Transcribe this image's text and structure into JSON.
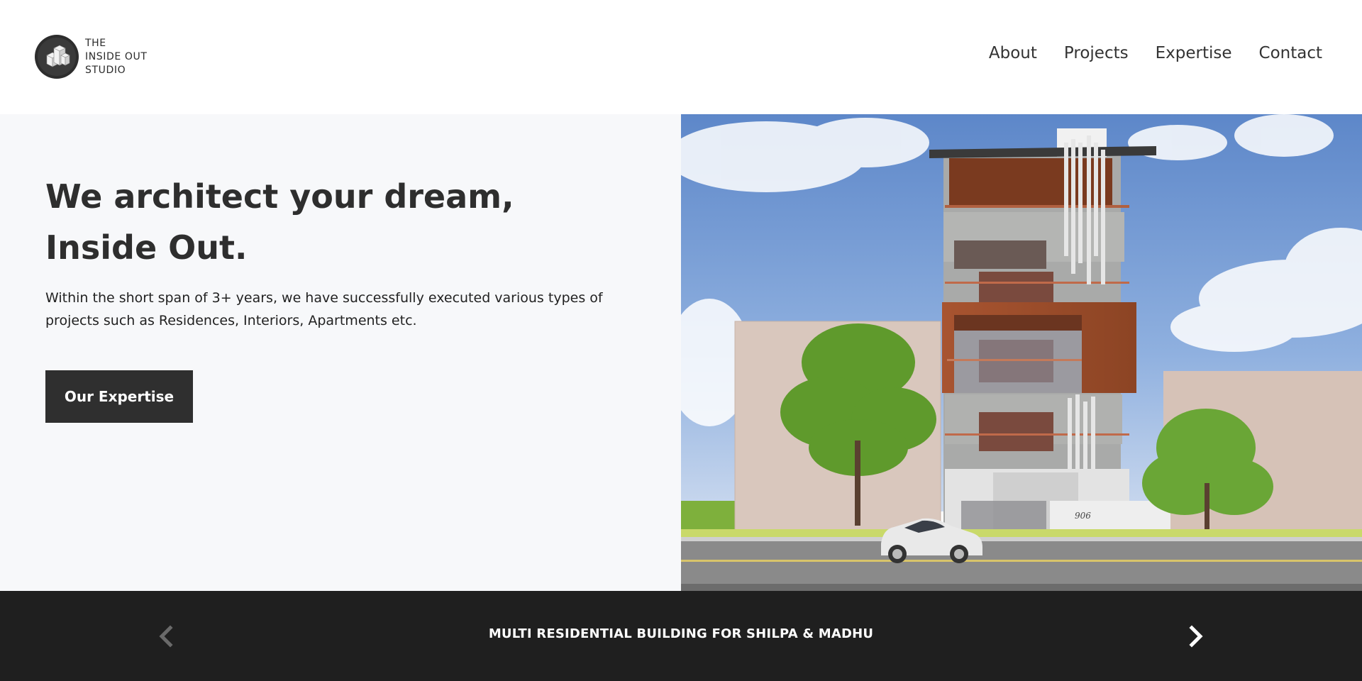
{
  "brand": {
    "line1": "THE",
    "line2": "INSIDE OUT",
    "line3": "STUDIO"
  },
  "nav": {
    "about": "About",
    "projects": "Projects",
    "expertise": "Expertise",
    "contact": "Contact"
  },
  "hero": {
    "title_line1": "We architect your dream,",
    "title_line2": "Inside Out.",
    "description": "Within the short span of 3+ years, we have successfully executed various types of projects such as Residences, Interiors, Apartments etc.",
    "cta_label": "Our Expertise"
  },
  "slider": {
    "caption": "MULTI RESIDENTIAL BUILDING FOR SHILPA & MADHU",
    "house_number": "906"
  },
  "colors": {
    "dark": "#2f2f2f",
    "bar": "#1f1f1f",
    "hero_bg": "#f7f8fa"
  }
}
